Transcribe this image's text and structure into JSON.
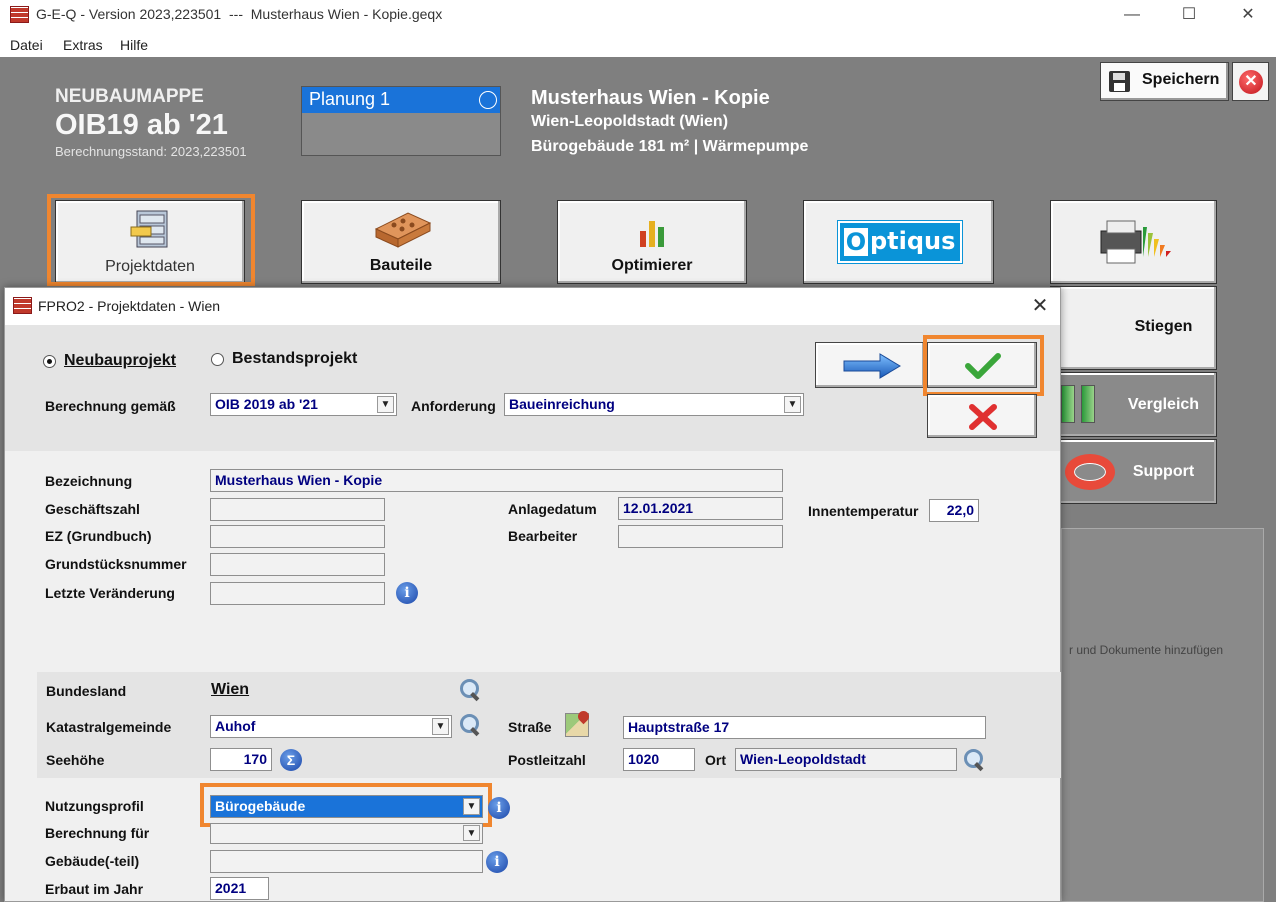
{
  "window": {
    "title": "G-E-Q - Version 2023,223501  ---  Musterhaus Wien - Kopie.geqx",
    "minimize": "—",
    "maximize": "☐",
    "close": "✕"
  },
  "menu": [
    "Datei",
    "Extras",
    "Hilfe"
  ],
  "header": {
    "label": "NEUBAUMAPPE",
    "oib": "OIB19 ab '21",
    "calc_state": "Berechnungsstand: 2023,223501",
    "plan": "Planung 1",
    "project_title": "Musterhaus Wien - Kopie",
    "location": "Wien-Leopoldstadt (Wien)",
    "info": "Bürogebäude  181 m²  |  Wärmepumpe",
    "save_label": "Speichern",
    "close_icon": "✕"
  },
  "toolbar": {
    "projektdaten": "Projektdaten",
    "bauteile": "Bauteile",
    "optimierer": "Optimierer",
    "optiqus": "Optiqus",
    "stiegen": "Stiegen",
    "vergleich": "Vergleich",
    "support": "Support",
    "documents_hint": "r und Dokumente hinzufügen"
  },
  "dialog": {
    "title": "FPRO2 - Projektdaten - Wien",
    "close": "✕",
    "radio_new": "Neubauprojekt",
    "radio_existing": "Bestandsprojekt",
    "calc_label": "Berechnung gemäß",
    "calc_value": "OIB 2019 ab '21",
    "req_label": "Anforderung",
    "req_value": "Baueinreichung",
    "fields": {
      "bezeichnung_label": "Bezeichnung",
      "bezeichnung_value": "Musterhaus Wien - Kopie",
      "geschaeftszahl_label": "Geschäftszahl",
      "geschaeftszahl_value": "",
      "anlagedatum_label": "Anlagedatum",
      "anlagedatum_value": "12.01.2021",
      "innentemp_label": "Innentemperatur",
      "innentemp_value": "22,0",
      "ez_label": "EZ (Grundbuch)",
      "ez_value": "",
      "bearbeiter_label": "Bearbeiter",
      "bearbeiter_value": "",
      "grundstueck_label": "Grundstücksnummer",
      "grundstueck_value": "",
      "letzte_label": "Letzte Veränderung",
      "letzte_value": ""
    },
    "location": {
      "bundesland_label": "Bundesland",
      "bundesland_value": "Wien",
      "kg_label": "Katastralgemeinde",
      "kg_value": "Auhof",
      "strasse_label": "Straße",
      "strasse_value": "Hauptstraße 17",
      "seehoehe_label": "Seehöhe",
      "seehoehe_value": "170",
      "plz_label": "Postleitzahl",
      "plz_value": "1020",
      "ort_label": "Ort",
      "ort_value": "Wien-Leopoldstadt"
    },
    "usage": {
      "nutzung_label": "Nutzungsprofil",
      "nutzung_value": "Bürogebäude",
      "berechnung_fuer_label": "Berechnung für",
      "berechnung_fuer_value": "",
      "gebaeude_label": "Gebäude(-teil)",
      "gebaeude_value": "",
      "erbaut_label": "Erbaut im Jahr",
      "erbaut_value": "2021"
    }
  },
  "colors": {
    "accent_highlight": "#f0862f",
    "selection_blue": "#1a73d9",
    "field_text": "#000080",
    "header_gray": "#7f7f7f"
  }
}
